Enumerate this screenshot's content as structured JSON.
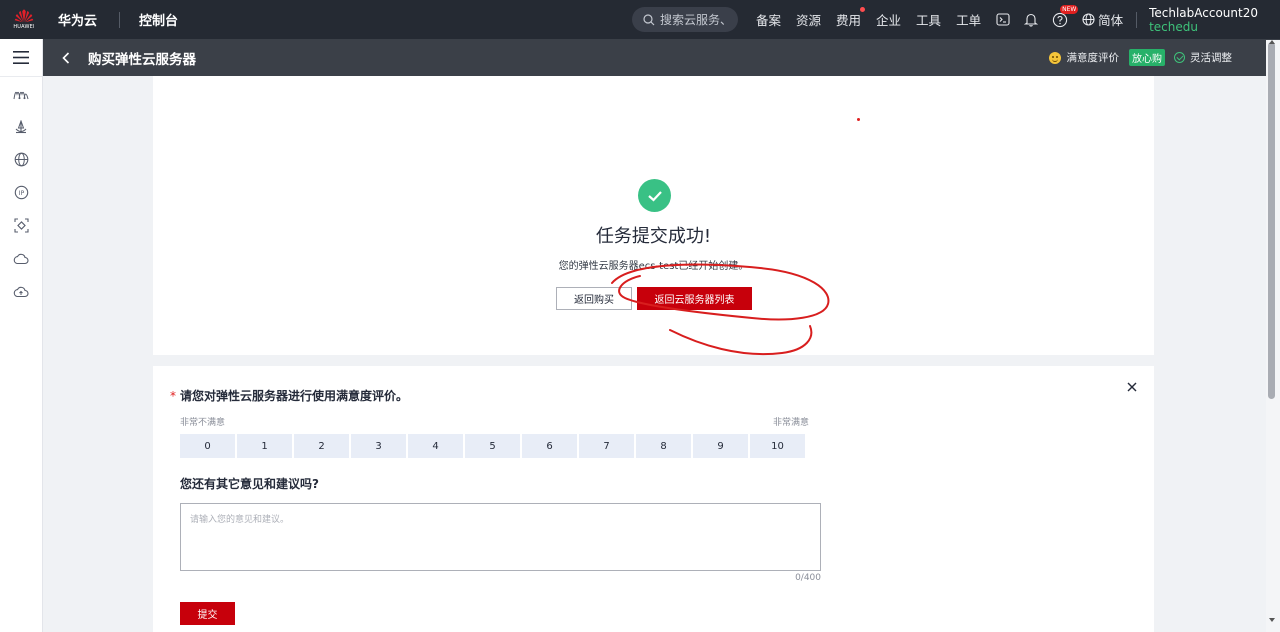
{
  "topbar": {
    "logo_text": "HUAWEI",
    "brand": "华为云",
    "console": "控制台",
    "search_placeholder": "搜索云服务、",
    "nav": [
      "备案",
      "资源",
      "费用",
      "企业",
      "工具",
      "工单"
    ],
    "new_badge": "NEW",
    "language": "简体",
    "account_name": "TechlabAccount20",
    "account_sub": "techedu"
  },
  "sidebar": {
    "icons": [
      "menu-icon",
      "network-wave-icon",
      "anchor-icon",
      "globe-icon",
      "ip-icon",
      "security-scan-icon",
      "cloud-icon",
      "cloud-upload-icon"
    ]
  },
  "pagebar": {
    "title": "购买弹性云服务器",
    "satisfaction": "满意度评价",
    "badge": "放心购",
    "flexible": "灵活调整"
  },
  "success": {
    "title": "任务提交成功!",
    "desc": "您的弹性云服务器ecs-test已经开始创建。",
    "btn_return_buy": "返回购买",
    "btn_return_list": "返回云服务器列表"
  },
  "survey": {
    "question1": "请您对弹性云服务器进行使用满意度评价。",
    "required_mark": "*",
    "scale_low": "非常不满意",
    "scale_high": "非常满意",
    "scale": [
      "0",
      "1",
      "2",
      "3",
      "4",
      "5",
      "6",
      "7",
      "8",
      "9",
      "10"
    ],
    "question2": "您还有其它意见和建议吗?",
    "textarea_placeholder": "请输入您的意见和建议。",
    "counter": "0/400",
    "submit": "提交"
  },
  "colors": {
    "topbar_bg": "#252a33",
    "pagebar_bg": "#3b4048",
    "brand_red": "#c7000b",
    "success_green": "#39c185",
    "scale_bg": "#e8edf7",
    "annotation_red": "#d81e1e"
  }
}
